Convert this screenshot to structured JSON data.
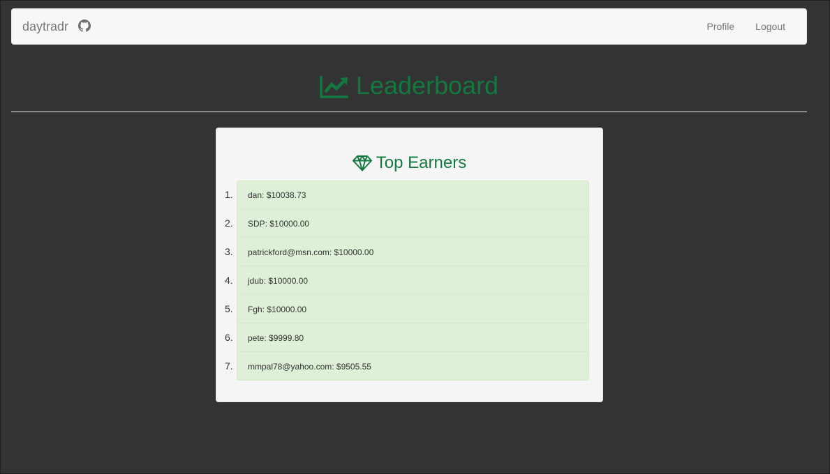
{
  "navbar": {
    "brand": "daytradr",
    "links": [
      {
        "label": "Profile"
      },
      {
        "label": "Logout"
      }
    ]
  },
  "header": {
    "title": "Leaderboard"
  },
  "leaderboard": {
    "title": "Top Earners",
    "entries": [
      {
        "rank": "1.",
        "text": "dan: $10038.73"
      },
      {
        "rank": "2.",
        "text": "SDP: $10000.00"
      },
      {
        "rank": "3.",
        "text": "patrickford@msn.com: $10000.00"
      },
      {
        "rank": "4.",
        "text": "jdub: $10000.00"
      },
      {
        "rank": "5.",
        "text": "Fgh: $10000.00"
      },
      {
        "rank": "6.",
        "text": "pete: $9999.80"
      },
      {
        "rank": "7.",
        "text": "mmpal78@yahoo.com: $9505.55"
      }
    ]
  },
  "colors": {
    "accent": "#137a3f",
    "background": "#333333",
    "navbar": "#f8f8f8",
    "card": "#f5f5f5",
    "list_item": "#dff0d8"
  },
  "icons": {
    "brand": "github-icon",
    "title": "line-chart-icon",
    "card_title": "diamond-icon"
  }
}
